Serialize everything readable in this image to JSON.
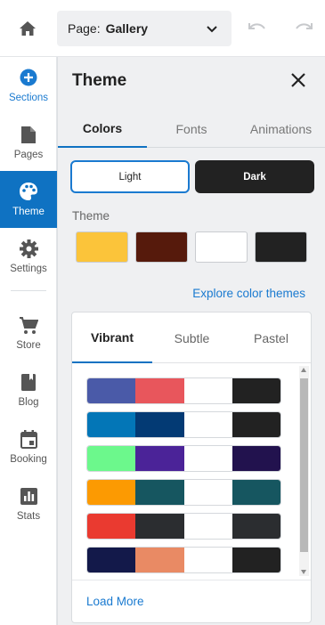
{
  "header": {
    "home_icon": "home-icon",
    "page_label": "Page:",
    "page_value": "Gallery",
    "undo_icon": "undo-icon",
    "redo_icon": "redo-icon"
  },
  "nav": {
    "items": [
      {
        "label": "Sections",
        "icon": "plus-circle-icon"
      },
      {
        "label": "Pages",
        "icon": "page-icon"
      },
      {
        "label": "Theme",
        "icon": "palette-icon",
        "active": true
      },
      {
        "label": "Settings",
        "icon": "gear-icon"
      },
      {
        "label": "Store",
        "icon": "cart-icon"
      },
      {
        "label": "Blog",
        "icon": "book-icon"
      },
      {
        "label": "Booking",
        "icon": "calendar-icon"
      },
      {
        "label": "Stats",
        "icon": "chart-icon"
      }
    ]
  },
  "panel": {
    "title": "Theme",
    "tabs": [
      "Colors",
      "Fonts",
      "Animations"
    ],
    "active_tab": "Colors",
    "mode_light": "Light",
    "mode_dark": "Dark",
    "theme_label": "Theme",
    "theme_swatches": [
      "#fbc43a",
      "#561a0c",
      "#ffffff",
      "#222222"
    ],
    "explore_link": "Explore color themes",
    "card": {
      "tabs": [
        "Vibrant",
        "Subtle",
        "Pastel"
      ],
      "active_tab": "Vibrant",
      "palettes": [
        [
          "#4a5aa8",
          "#e8565c",
          "#ffffff",
          "#222222"
        ],
        [
          "#0376b7",
          "#033a74",
          "#ffffff",
          "#222222"
        ],
        [
          "#6cf88c",
          "#4b2398",
          "#ffffff",
          "#22124e"
        ],
        [
          "#fc9a02",
          "#165660",
          "#ffffff",
          "#165660"
        ],
        [
          "#ea3a30",
          "#2b2d30",
          "#ffffff",
          "#2b2d30"
        ],
        [
          "#13194a",
          "#e98a64",
          "#ffffff",
          "#222222"
        ]
      ],
      "load_more": "Load More"
    }
  },
  "colors": {
    "accent": "#0f72c2",
    "link": "#1a7ad0"
  }
}
